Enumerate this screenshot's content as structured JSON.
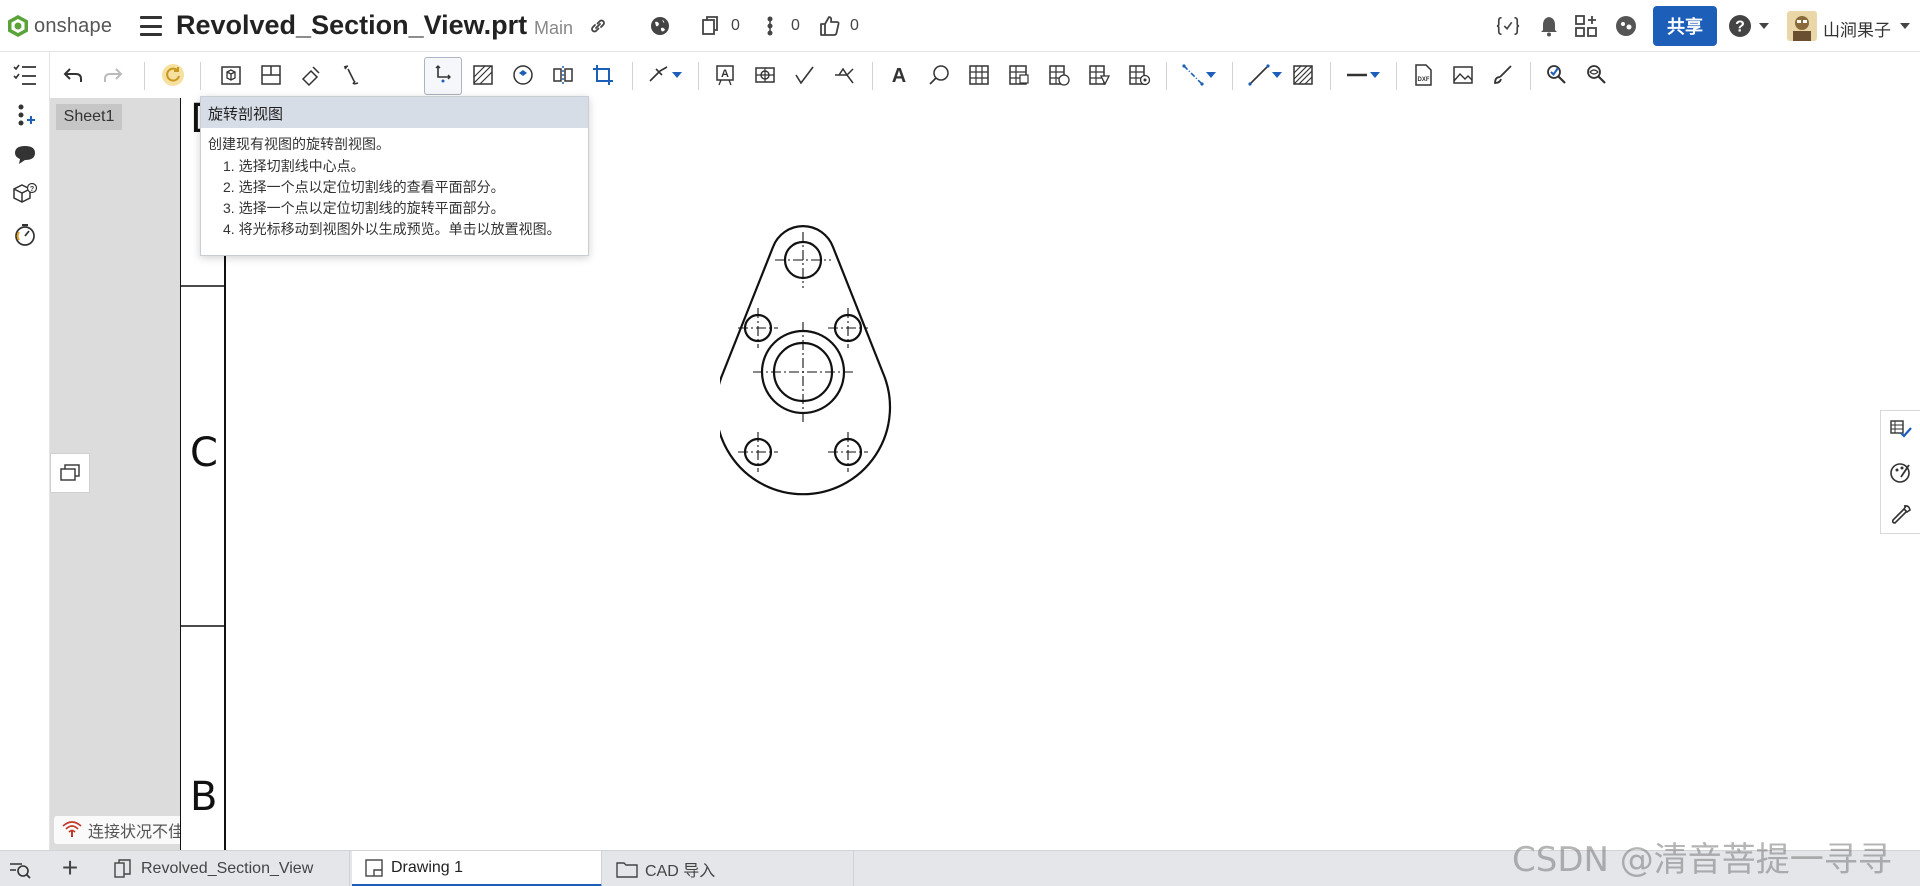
{
  "app": {
    "logo_text": "onshape",
    "document_title": "Revolved_Section_View.prt",
    "branch": "Main",
    "counts": {
      "versions": "0",
      "branches": "0",
      "likes": "0"
    },
    "share_label": "共享",
    "user_name": "山涧果子"
  },
  "sheets": {
    "items": [
      {
        "label": "Sheet1"
      }
    ],
    "connection_status": "连接状况不佳..."
  },
  "tooltip": {
    "title": "旋转剖视图",
    "description": "创建现有视图的旋转剖视图。",
    "steps": [
      "1. 选择切割线中心点。",
      "2. 选择一个点以定位切割线的查看平面部分。",
      "3. 选择一个点以定位切割线的旋转平面部分。",
      "4. 将光标移动到视图外以生成预览。单击以放置视图。"
    ]
  },
  "drawing": {
    "zone_letters": {
      "top": "D",
      "middle": "C",
      "bottom": "B"
    }
  },
  "tabs": {
    "items": [
      {
        "label": "Revolved_Section_View",
        "icon": "part-studio-icon"
      },
      {
        "label": "Drawing 1",
        "icon": "drawing-icon",
        "active": true
      },
      {
        "label": "CAD 导入",
        "icon": "folder-icon"
      }
    ]
  },
  "watermark": "CSDN @清音菩提一寻寻",
  "colors": {
    "accent": "#1d5eb8",
    "logo_green": "#5aa33a",
    "tooltip_header": "#d7dde6",
    "sheet_panel": "#dcdcdc"
  }
}
